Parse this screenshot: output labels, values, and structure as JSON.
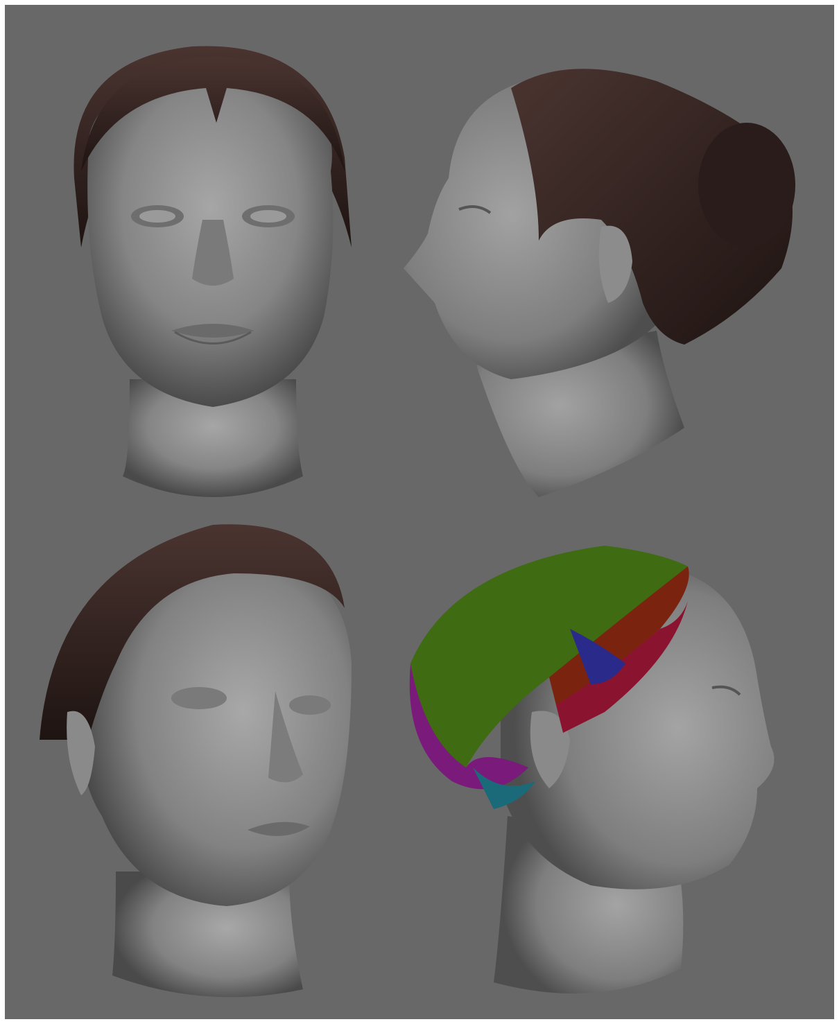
{
  "background_color": "#686868",
  "frame_color": "#ffffff",
  "hair_color": "#2e1f1d",
  "skin_color": "#8a8a8a",
  "views": [
    {
      "id": "front",
      "description_icon": "head-front-view"
    },
    {
      "id": "profile-right",
      "description_icon": "head-profile-view"
    },
    {
      "id": "three-quarter",
      "description_icon": "head-three-quarter-view"
    },
    {
      "id": "profile-left-hair-groups",
      "description_icon": "head-hair-groups-view"
    }
  ],
  "hair_group_colors": [
    "#3f6b12",
    "#7a2410",
    "#8a1330",
    "#2a2a8a",
    "#7a1a7a",
    "#1a6a7a"
  ]
}
